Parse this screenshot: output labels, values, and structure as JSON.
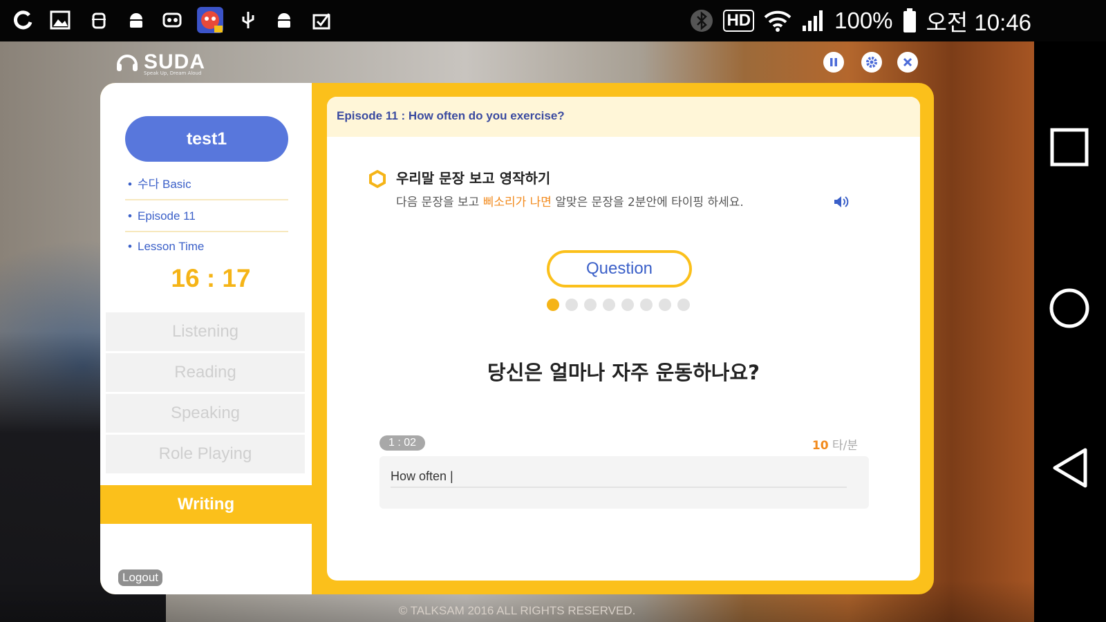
{
  "status_bar": {
    "icons": [
      "app-icon",
      "gallery-icon",
      "android-debug-icon",
      "android-icon",
      "game-icon",
      "game-avatar-icon",
      "usb-icon",
      "android-icon",
      "clipboard-check-icon"
    ],
    "bluetooth": "bluetooth-icon",
    "hd": "HD",
    "battery_percent": "100%",
    "time": "오전 10:46"
  },
  "app": {
    "logo": "SUDA",
    "logo_sub": "Speak Up, Dream Aloud",
    "controls": [
      "pause-icon",
      "settings-icon",
      "close-icon"
    ]
  },
  "sidebar": {
    "user": "test1",
    "course": "수다 Basic",
    "episode": "Episode 11",
    "lesson_time_label": "Lesson Time",
    "lesson_time": "16 : 17",
    "menu": [
      "Listening",
      "Reading",
      "Speaking",
      "Role Playing"
    ],
    "active_menu": "Writing",
    "logout": "Logout"
  },
  "main": {
    "episode_title": "Episode 11 : How often do you exercise?",
    "instruction_title": "우리말 문장 보고 영작하기",
    "instruction_pre": "다음 문장을 보고 ",
    "instruction_highlight": "삐소리가 나면",
    "instruction_post": " 알맞은 문장을 2분안에 타이핑 하세요.",
    "question_button": "Question",
    "progress": {
      "current": 1,
      "total": 8
    },
    "sentence": "당신은 얼마나 자주 운동하나요?",
    "elapsed": "1 : 02",
    "speed_value": "10",
    "speed_unit": " 타/분",
    "typed_text": "How often |"
  },
  "footer": {
    "copyright": "© TALKSAM 2016 ALL RIGHTS RESERVED."
  },
  "colors": {
    "accent": "#fbc01b",
    "primary": "#5877dc",
    "highlight": "#f28a1c"
  }
}
